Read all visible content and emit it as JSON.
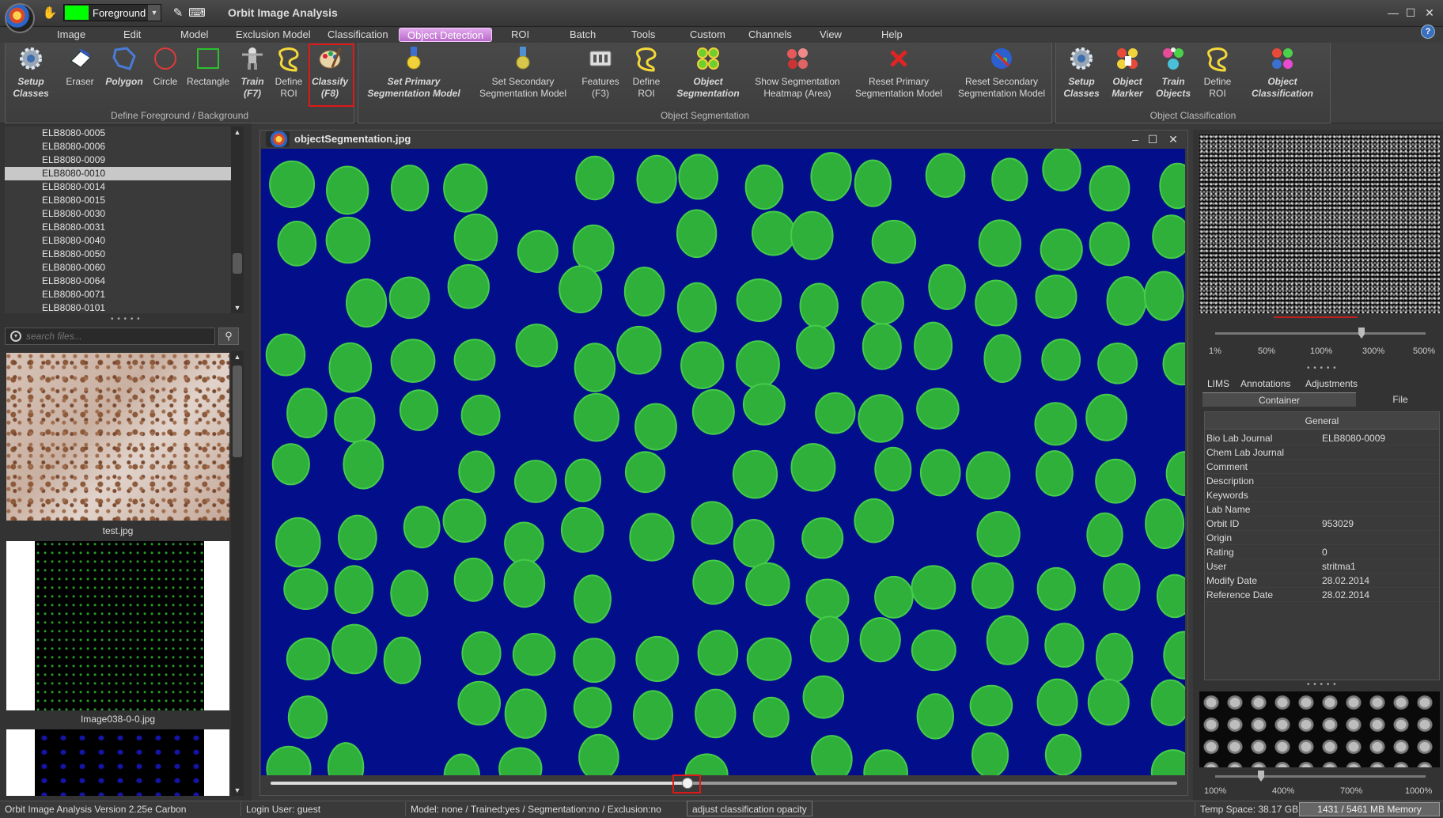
{
  "window": {
    "title": "Orbit Image Analysis",
    "minimize": "—",
    "maximize": "☐",
    "close": "✕"
  },
  "toolbar": {
    "foreground_label": "Foreground",
    "foreground_color": "#00ff00"
  },
  "menu": {
    "items": [
      "Image",
      "Edit",
      "Model",
      "Exclusion Model",
      "Classification",
      "Object Detection",
      "ROI",
      "Batch",
      "Tools",
      "Custom",
      "Channels",
      "View",
      "Help"
    ],
    "active": "Object Detection"
  },
  "ribbon": {
    "groups": [
      {
        "label": "Define Foreground / Background"
      },
      {
        "label": "Object Segmentation"
      },
      {
        "label": "Object Classification"
      }
    ],
    "g1": {
      "setup_classes": [
        "Setup",
        "Classes"
      ],
      "eraser": "Eraser",
      "polygon": "Polygon",
      "circle": "Circle",
      "rectangle": "Rectangle",
      "train": [
        "Train",
        "(F7)"
      ],
      "define_roi": [
        "Define",
        "ROI"
      ],
      "classify": [
        "Classify",
        "(F8)"
      ]
    },
    "g2": {
      "set_primary": [
        "Set Primary",
        "Segmentation Model"
      ],
      "set_secondary": [
        "Set Secondary",
        "Segmentation Model"
      ],
      "features": [
        "Features",
        "(F3)"
      ],
      "define_roi": [
        "Define",
        "ROI"
      ],
      "object_segmentation": [
        "Object",
        "Segmentation"
      ],
      "show_heatmap": [
        "Show Segmentation",
        "Heatmap (Area)"
      ],
      "reset_primary": [
        "Reset Primary",
        "Segmentation Model"
      ],
      "reset_secondary": [
        "Reset Secondary",
        "Segmentation Model"
      ]
    },
    "g3": {
      "setup_classes": [
        "Setup",
        "Classes"
      ],
      "object_marker": [
        "Object",
        "Marker"
      ],
      "train_objects": [
        "Train",
        "Objects"
      ],
      "define_roi": [
        "Define",
        "ROI"
      ],
      "object_classification": [
        "Object",
        "Classification"
      ]
    }
  },
  "file_list": {
    "items": [
      "ELB8080-0005",
      "ELB8080-0006",
      "ELB8080-0009",
      "ELB8080-0010",
      "ELB8080-0014",
      "ELB8080-0015",
      "ELB8080-0030",
      "ELB8080-0031",
      "ELB8080-0040",
      "ELB8080-0050",
      "ELB8080-0060",
      "ELB8080-0064",
      "ELB8080-0071",
      "ELB8080-0101"
    ],
    "selected": "ELB8080-0010"
  },
  "search": {
    "placeholder": "search files..."
  },
  "thumbnails": [
    "test.jpg",
    "Image038-0-0.jpg"
  ],
  "viewer": {
    "title": "objectSegmentation.jpg",
    "tooltip": "adjust classification opacity",
    "opacity": 0.46
  },
  "overview_zoom": {
    "labels": [
      "1%",
      "50%",
      "100%",
      "300%",
      "500%"
    ]
  },
  "panel_tabs": {
    "row1": [
      "LIMS",
      "Annotations",
      "Adjustments"
    ],
    "row2": [
      "Container",
      "File"
    ],
    "active": "Container"
  },
  "properties": {
    "header": "General",
    "rows": [
      {
        "key": "Bio Lab Journal",
        "value": "ELB8080-0009"
      },
      {
        "key": "Chem Lab Journal",
        "value": ""
      },
      {
        "key": "Comment",
        "value": ""
      },
      {
        "key": "Description",
        "value": ""
      },
      {
        "key": "Keywords",
        "value": ""
      },
      {
        "key": "Lab Name",
        "value": ""
      },
      {
        "key": "Orbit ID",
        "value": "953029"
      },
      {
        "key": "Origin",
        "value": ""
      },
      {
        "key": "Rating",
        "value": "0"
      },
      {
        "key": "User",
        "value": "stritma1"
      },
      {
        "key": "Modify Date",
        "value": "28.02.2014"
      },
      {
        "key": "Reference Date",
        "value": "28.02.2014"
      }
    ]
  },
  "minimap_zoom": {
    "labels": [
      "100%",
      "400%",
      "700%",
      "1000%"
    ]
  },
  "status": {
    "version": "Orbit Image Analysis Version 2.25e Carbon",
    "login": "Login User: guest",
    "model": "Model: none / Trained:yes / Segmentation:no / Exclusion:no",
    "temp": "Temp Space: 38.17 GB",
    "memory": "1431 / 5461 MB Memory"
  }
}
